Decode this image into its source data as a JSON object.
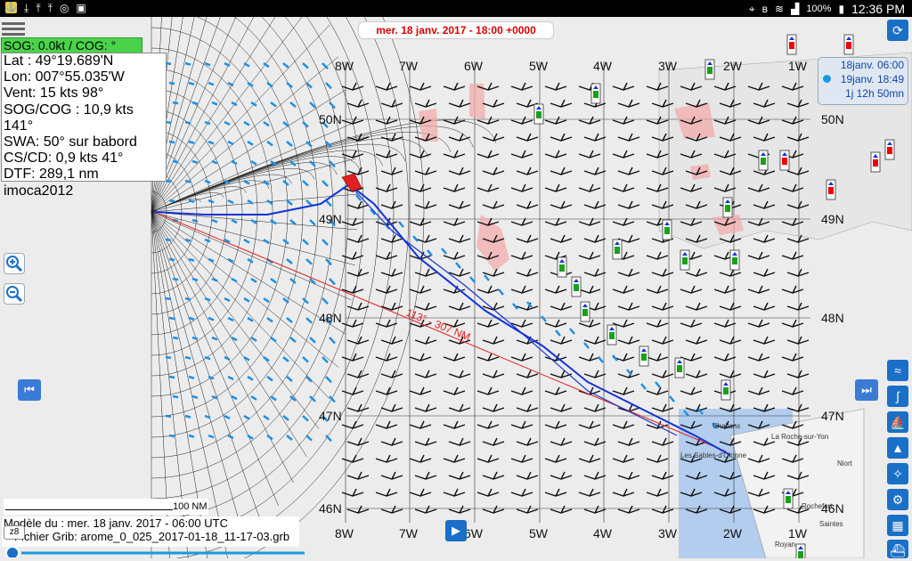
{
  "status": {
    "time": "12:36 PM",
    "battery": "100%",
    "left_icons": [
      "app-icon",
      "download-icon",
      "upload-icon",
      "upload-icon",
      "compass-icon",
      "briefcase-icon"
    ],
    "right_icons": [
      "location-icon",
      "bluetooth-icon",
      "wifi-icon",
      "signal-icon",
      "battery-icon"
    ]
  },
  "map": {
    "timebar": "mer. 18 janv. 2017 - 18:00 +0000",
    "sog_cog": "SOG: 0.0kt / COG:    °",
    "info": [
      "Lat :  49°19.689'N",
      "Lon: 007°55.035'W",
      "Vent:  15 kts  98°",
      "SOG/COG : 10,9 kts 141°",
      "SWA: 50° sur babord",
      "CS/CD: 0,9 kts 41°",
      "DTF: 289,1 nm",
      "imoca2012"
    ],
    "lon_labels": [
      "8W",
      "7W",
      "6W",
      "5W",
      "4W",
      "3W",
      "2W",
      "1W"
    ],
    "lat_labels": [
      "50N",
      "49N",
      "48N",
      "47N",
      "46N"
    ],
    "route_label": "113° - 307 NM",
    "places": [
      "Challans",
      "Les Sables-d'Olonne",
      "La Roche-sur-Yon",
      "Niort",
      "Rochefort",
      "Saintes",
      "Royan"
    ],
    "scale": "100 NM",
    "zoom_level": "z8",
    "model": "Modèle du : mer. 18 janv. 2017 - 06:00 UTC",
    "grib": "Fichier Grib: arome_0_025_2017-01-18_11-17-03.grb",
    "eta": [
      "18janv. 06:00",
      "19janv. 18:49",
      "1j 12h 50mn"
    ]
  },
  "colors": {
    "route": "#1434d6",
    "rhumb": "#e02020",
    "wind_arrows": "#1e8fe6",
    "sea_shallow": "#a9c8ee"
  }
}
